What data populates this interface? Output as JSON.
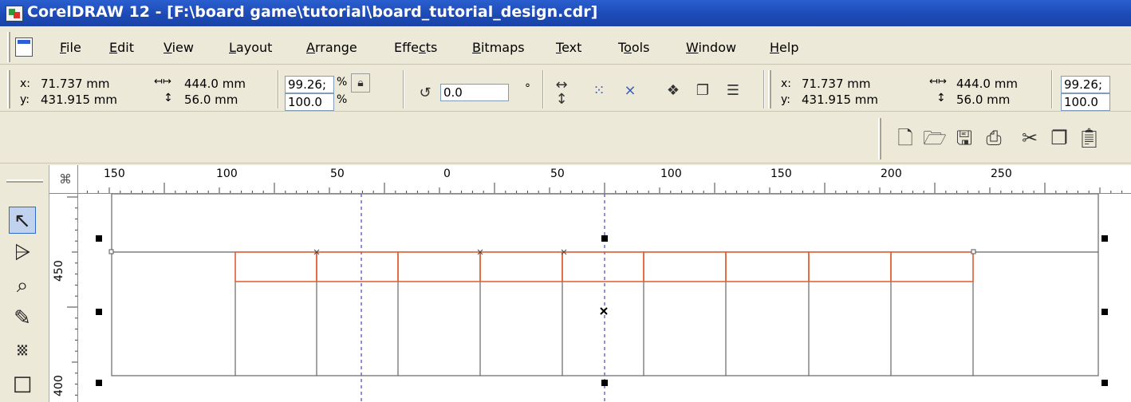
{
  "window": {
    "title": "CorelDRAW 12 - [F:\\board game\\tutorial\\board_tutorial_design.cdr]"
  },
  "menu": [
    {
      "pre": "",
      "u": "F",
      "post": "ile"
    },
    {
      "pre": "",
      "u": "E",
      "post": "dit"
    },
    {
      "pre": "",
      "u": "V",
      "post": "iew"
    },
    {
      "pre": "",
      "u": "L",
      "post": "ayout"
    },
    {
      "pre": "",
      "u": "A",
      "post": "rrange"
    },
    {
      "pre": "Effe",
      "u": "c",
      "post": "ts"
    },
    {
      "pre": "",
      "u": "B",
      "post": "itmaps"
    },
    {
      "pre": "",
      "u": "T",
      "post": "ext"
    },
    {
      "pre": "T",
      "u": "o",
      "post": "ols"
    },
    {
      "pre": "",
      "u": "W",
      "post": "indow"
    },
    {
      "pre": "",
      "u": "H",
      "post": "elp"
    }
  ],
  "property_bar": {
    "x_label": "x:",
    "x_value": "71.737 mm",
    "y_label": "y:",
    "y_value": "431.915 mm",
    "width_value": "444.0 mm",
    "height_value": "56.0 mm",
    "scale_x_value": "99.26;",
    "scale_y_value": "100.0",
    "percent_symbol": "%",
    "rotation_value": "0.0",
    "degree_symbol": "°",
    "x_value_2": "71.737 mm",
    "y_value_2": "431.915 mm",
    "width_value_2": "444.0 mm",
    "height_value_2": "56.0 mm",
    "scale_x_value_2": "99.26;",
    "scale_y_value_2": "100.0"
  },
  "ruler_h_labels": [
    "150",
    "100",
    "50",
    "0",
    "50",
    "100",
    "150",
    "200",
    "250"
  ],
  "ruler_v_labels": [
    "450",
    "400"
  ],
  "colors": {
    "title_bar": "#1c49b4",
    "selection_outline": "#e2653a",
    "guide": "#6a6acf"
  },
  "icons": {
    "std": [
      "new-icon",
      "open-icon",
      "save-icon",
      "print-icon",
      "cut-icon",
      "copy-icon",
      "paste-icon"
    ],
    "tools": [
      "pick-tool-icon",
      "shape-tool-icon",
      "zoom-tool-icon",
      "freehand-tool-icon",
      "smart-drawing-tool-icon",
      "rectangle-tool-icon"
    ]
  }
}
